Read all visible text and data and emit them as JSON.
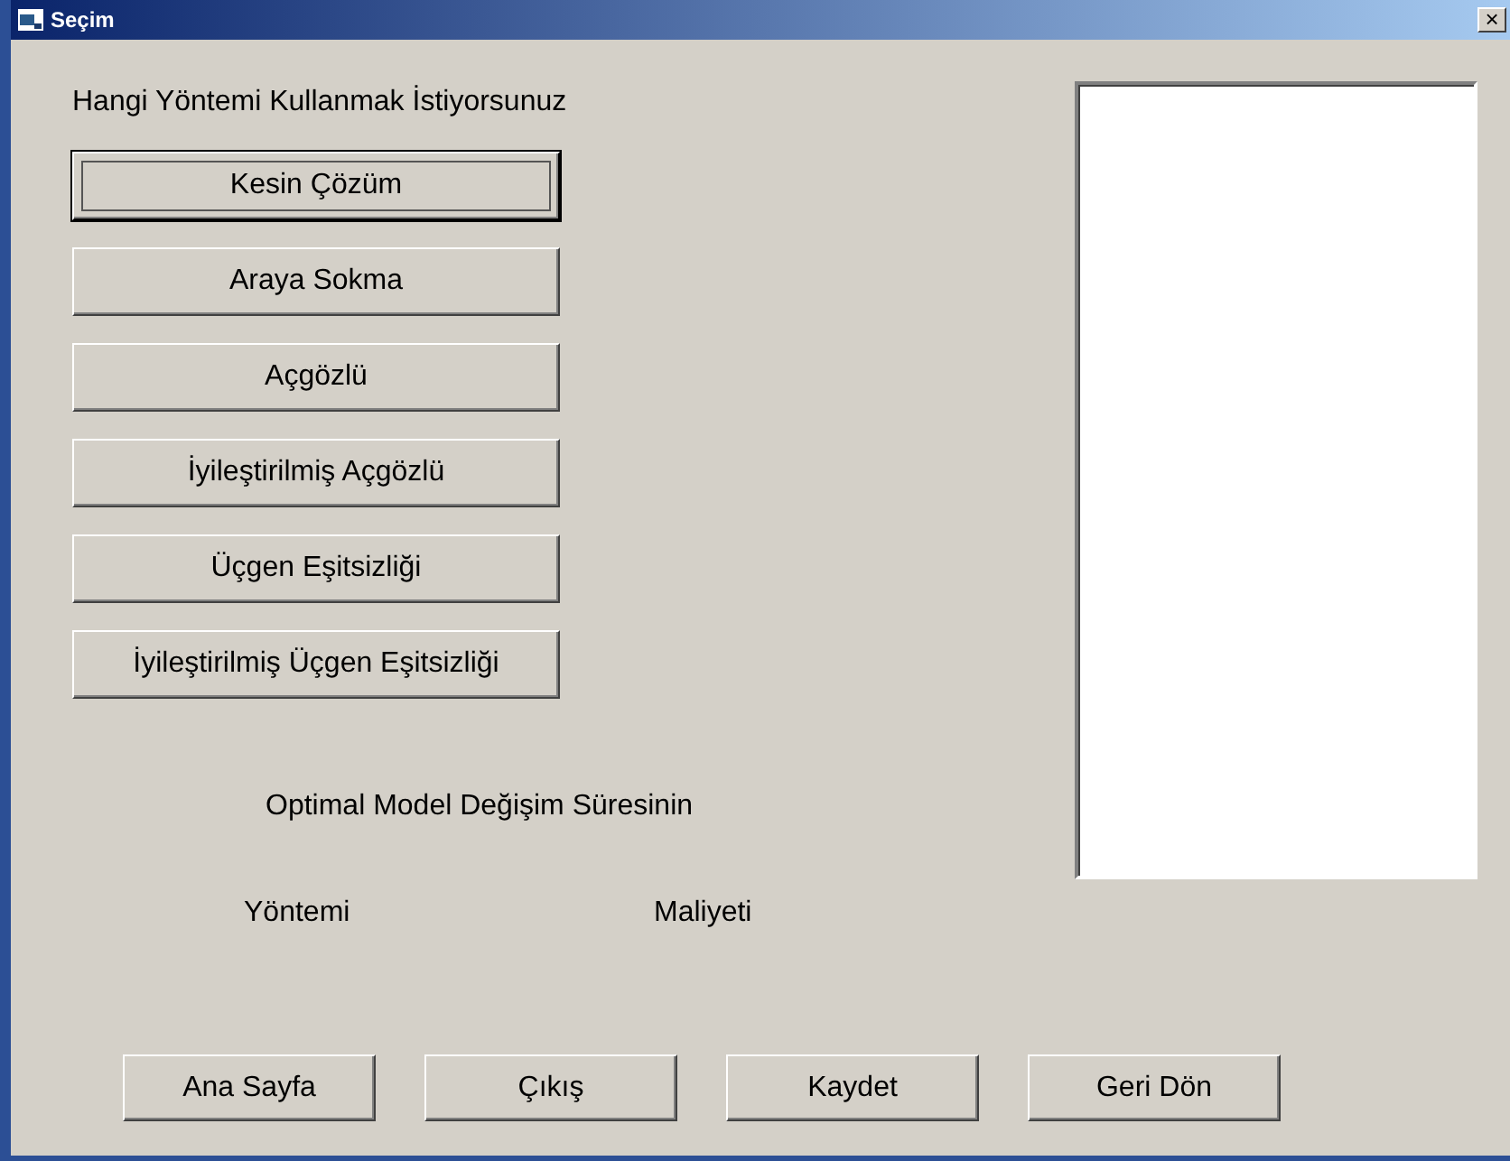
{
  "window": {
    "title": "Seçim",
    "close": "×"
  },
  "prompt": "Hangi Yöntemi Kullanmak İstiyorsunuz",
  "methods": [
    {
      "label": "Kesin Çözüm",
      "focused": true
    },
    {
      "label": "Araya Sokma",
      "focused": false
    },
    {
      "label": "Açgözlü",
      "focused": false
    },
    {
      "label": "İyileştirilmiş Açgözlü",
      "focused": false
    },
    {
      "label": "Üçgen Eşitsizliği",
      "focused": false
    },
    {
      "label": "İyileştirilmiş Üçgen Eşitsizliği",
      "focused": false
    }
  ],
  "result": {
    "heading": "Optimal Model Değişim Süresinin",
    "method_label": "Yöntemi",
    "cost_label": "Maliyeti"
  },
  "buttons": [
    "Ana Sayfa",
    "Çıkış",
    "Kaydet",
    "Geri Dön"
  ]
}
